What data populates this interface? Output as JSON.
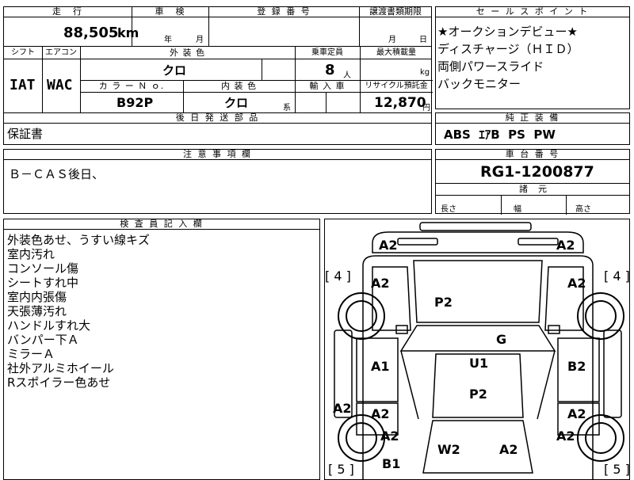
{
  "top": {
    "mileage_header": "走　行",
    "mileage_value": "88,505",
    "mileage_unit": "km",
    "inspection_header": "車　検",
    "inspection_year": "年",
    "inspection_month": "月",
    "registration_header": "登 録 番 号",
    "transfer_header": "譲渡書類期限",
    "transfer_month": "月",
    "transfer_day": "日"
  },
  "row2": {
    "shift_header": "シフト",
    "shift_value": "IAT",
    "aircon_header": "エアコン",
    "aircon_value": "WAC",
    "exterior_header": "外 装 色",
    "exterior_value": "クロ",
    "capacity_header": "乗車定員",
    "capacity_value": "8",
    "capacity_unit": "人",
    "maxload_header": "最大積載量",
    "maxload_unit": "kg",
    "colorno_header": "カ ラ ー Ｎ ｏ.",
    "colorno_value": "B92P",
    "interior_header": "内 装 色",
    "interior_value": "クロ",
    "interior_suffix": "系",
    "import_header": "輸 入 車",
    "recycle_header": "リサイクル預託金",
    "recycle_value": "12,870",
    "recycle_unit": "円"
  },
  "later_parts": {
    "header": "後 日 発 送 部 品",
    "value": "保証書"
  },
  "cautions": {
    "header": "注 意 事 項 欄",
    "value": "Ｂ－ＣＡＳ後日、"
  },
  "sales_points": {
    "header": "セ ー ル ス ポ イ ン ト",
    "lines": [
      "★オークションデビュー★",
      "ディスチャージ（ＨＩＤ）",
      "両側パワースライド",
      "バックモニター"
    ]
  },
  "genuine_equipment": {
    "header": "純 正 装 備",
    "value": "ABS  ｴｱB  PS  PW"
  },
  "chassis": {
    "header": "車 台 番 号",
    "value": "RG1-1200877"
  },
  "dimensions": {
    "header": "諸　元",
    "length_label": "長さ",
    "width_label": "幅",
    "height_label": "高さ"
  },
  "inspector_notes": {
    "header": "検 査 員 記 入 欄",
    "lines": [
      "外装色あせ、うすい線キズ",
      "室内汚れ",
      "コンソール傷",
      "シートすれ中",
      "室内内張傷",
      "天張薄汚れ",
      "ハンドルすれ大",
      "バンパー下Ａ",
      "ミラーＡ",
      "社外アルミホイール",
      "Rスポイラー色あせ"
    ]
  },
  "diagram": {
    "tire_front_left": "[ 4 ]",
    "tire_front_right": "[ 4 ]",
    "tire_rear_left": "[ 5 ]",
    "tire_rear_right": "[ 5 ]",
    "marks": {
      "bumper_front_left": "A2",
      "bumper_front_right": "A2",
      "fender_front_left": "A2",
      "fender_front_right": "A2",
      "hood": "P2",
      "windshield": "G",
      "door_front_left": "A1",
      "door_front_right": "B2",
      "roof": "U1",
      "roof_rear": "P2",
      "rocker_left": "A2",
      "door_rear_left": "A2",
      "door_rear_right": "A2",
      "quarter_left": "A2",
      "quarter_right": "A2",
      "rear_window": "W2",
      "trunk": "A2",
      "bumper_rear_left": "B1"
    }
  }
}
